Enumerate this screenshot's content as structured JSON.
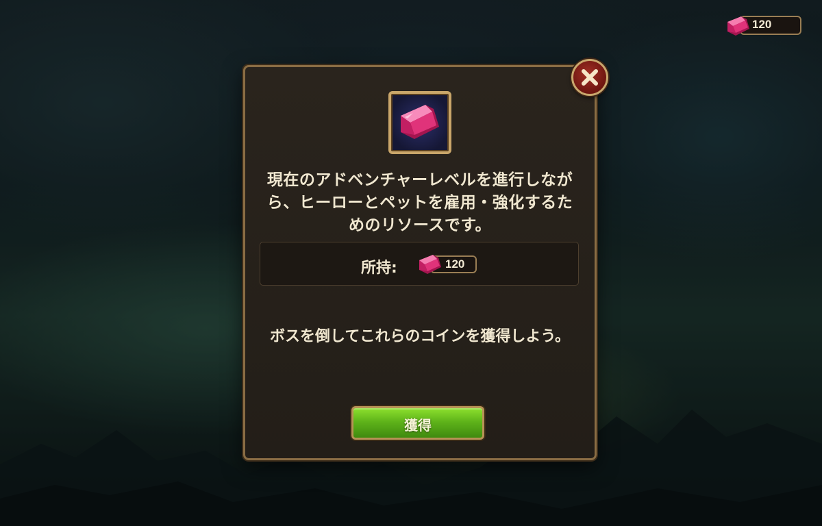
{
  "topbar": {
    "currency_icon": "pink-gem-icon",
    "currency_value": "120"
  },
  "dialog": {
    "item_icon": "pink-gem-icon",
    "description": "現在のアドベンチャーレベルを進行しながら、ヒーローとペットを雇用・強化するためのリソースです。",
    "owned_label": "所持:",
    "owned_value": "120",
    "hint": "ボスを倒してこれらのコインを獲得しよう。",
    "get_button_label": "獲得",
    "close_icon": "close-icon"
  },
  "colors": {
    "gem": "#e0337a",
    "button_green": "#5fb41a",
    "frame_gold": "#c9a66a",
    "close_red": "#8e231b"
  }
}
